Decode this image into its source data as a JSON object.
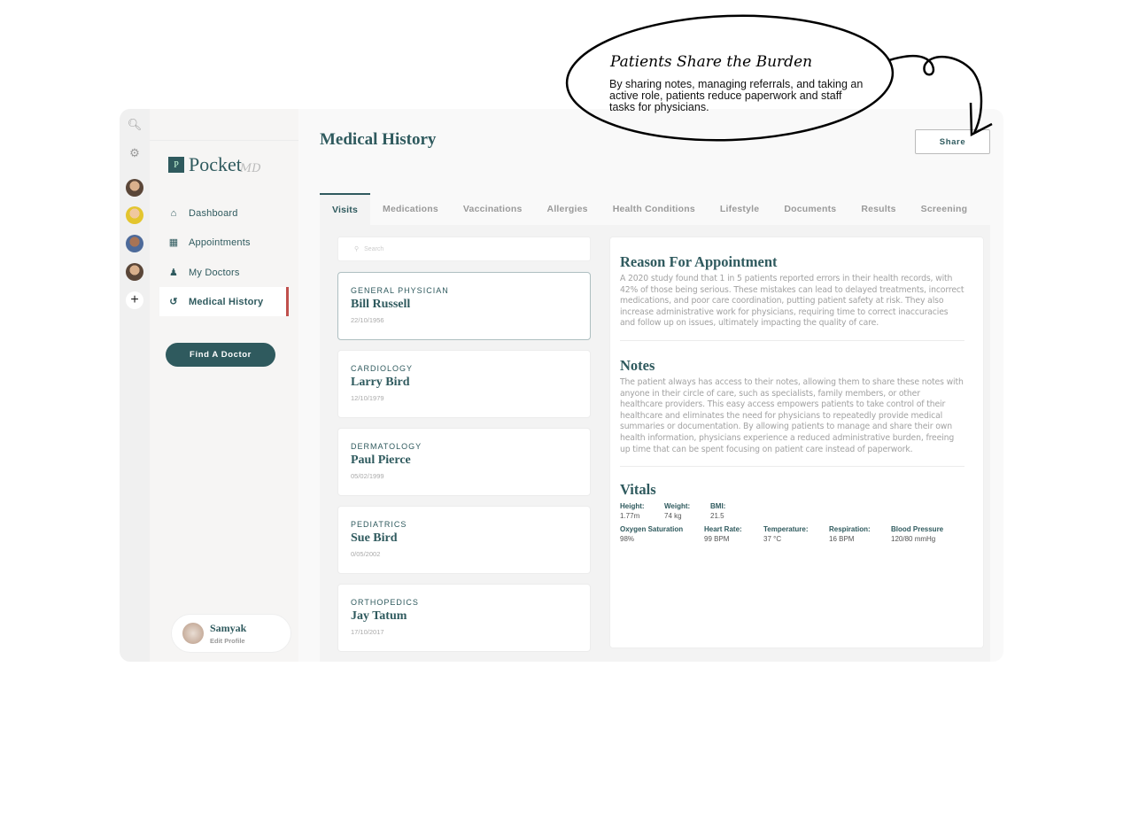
{
  "callout": {
    "title": "Patients Share the Burden",
    "text": "By sharing notes, managing referrals, and taking an active role, patients reduce paperwork and staff tasks for physicians."
  },
  "rail": {
    "icons": [
      "search-icon",
      "gear-icon",
      "avatar",
      "avatar",
      "avatar",
      "avatar",
      "plus-icon"
    ]
  },
  "sidebar": {
    "logo": {
      "mark": "P",
      "name": "Pocket",
      "suffix": "MD"
    },
    "items": [
      {
        "label": "Dashboard",
        "icon": "home-icon"
      },
      {
        "label": "Appointments",
        "icon": "calendar-icon"
      },
      {
        "label": "My Doctors",
        "icon": "doctor-icon"
      },
      {
        "label": "Medical History",
        "icon": "history-icon",
        "active": true
      }
    ],
    "find_label": "Find A Doctor",
    "profile": {
      "name": "Samyak",
      "edit": "Edit Profile"
    }
  },
  "header": {
    "title": "Medical History",
    "share_label": "Share"
  },
  "tabs": [
    "Visits",
    "Medications",
    "Vaccinations",
    "Allergies",
    "Health Conditions",
    "Lifestyle",
    "Documents",
    "Results",
    "Screening"
  ],
  "search": {
    "placeholder": "Search"
  },
  "visits": [
    {
      "specialty": "GENERAL PHYSICIAN",
      "doctor": "Bill Russell",
      "date": "22/10/1956"
    },
    {
      "specialty": "CARDIOLOGY",
      "doctor": "Larry Bird",
      "date": "12/10/1979"
    },
    {
      "specialty": "DERMATOLOGY",
      "doctor": "Paul Pierce",
      "date": "05/02/1999"
    },
    {
      "specialty": "PEDIATRICS",
      "doctor": "Sue Bird",
      "date": "0/05/2002"
    },
    {
      "specialty": "ORTHOPEDICS",
      "doctor": "Jay Tatum",
      "date": "17/10/2017"
    }
  ],
  "detail": {
    "reason": {
      "title": "Reason For Appointment",
      "text": "A 2020 study found that 1 in 5 patients reported errors in their health records, with 42% of those being serious. These mistakes can lead to delayed treatments, incorrect medications, and poor care coordination, putting patient safety at risk. They also increase administrative work for physicians, requiring time to correct inaccuracies and follow up on issues, ultimately impacting the quality of care."
    },
    "notes": {
      "title": "Notes",
      "text": "The patient always has access to their notes, allowing them to share these notes with anyone in their circle of care, such as specialists, family members, or other healthcare providers. This easy access empowers patients to take control of their healthcare and eliminates the need for physicians to repeatedly provide medical summaries or documentation. By allowing patients to manage and share their own health information, physicians experience a reduced administrative burden, freeing up time that can be spent focusing on patient care instead of paperwork."
    },
    "vitals": {
      "title": "Vitals",
      "row1": [
        {
          "label": "Height:",
          "value": "1.77m"
        },
        {
          "label": "Weight:",
          "value": "74 kg"
        },
        {
          "label": "BMI:",
          "value": "21.5"
        }
      ],
      "row2": [
        {
          "label": "Oxygen Saturation",
          "value": "98%"
        },
        {
          "label": "Heart Rate:",
          "value": "99 BPM"
        },
        {
          "label": "Temperature:",
          "value": "37 °C"
        },
        {
          "label": "Respiration:",
          "value": "16 BPM"
        },
        {
          "label": "Blood Pressure",
          "value": "120/80 mmHg"
        }
      ]
    }
  },
  "colors": {
    "primary": "#2f5a5e",
    "active_marker": "#c0504d"
  }
}
